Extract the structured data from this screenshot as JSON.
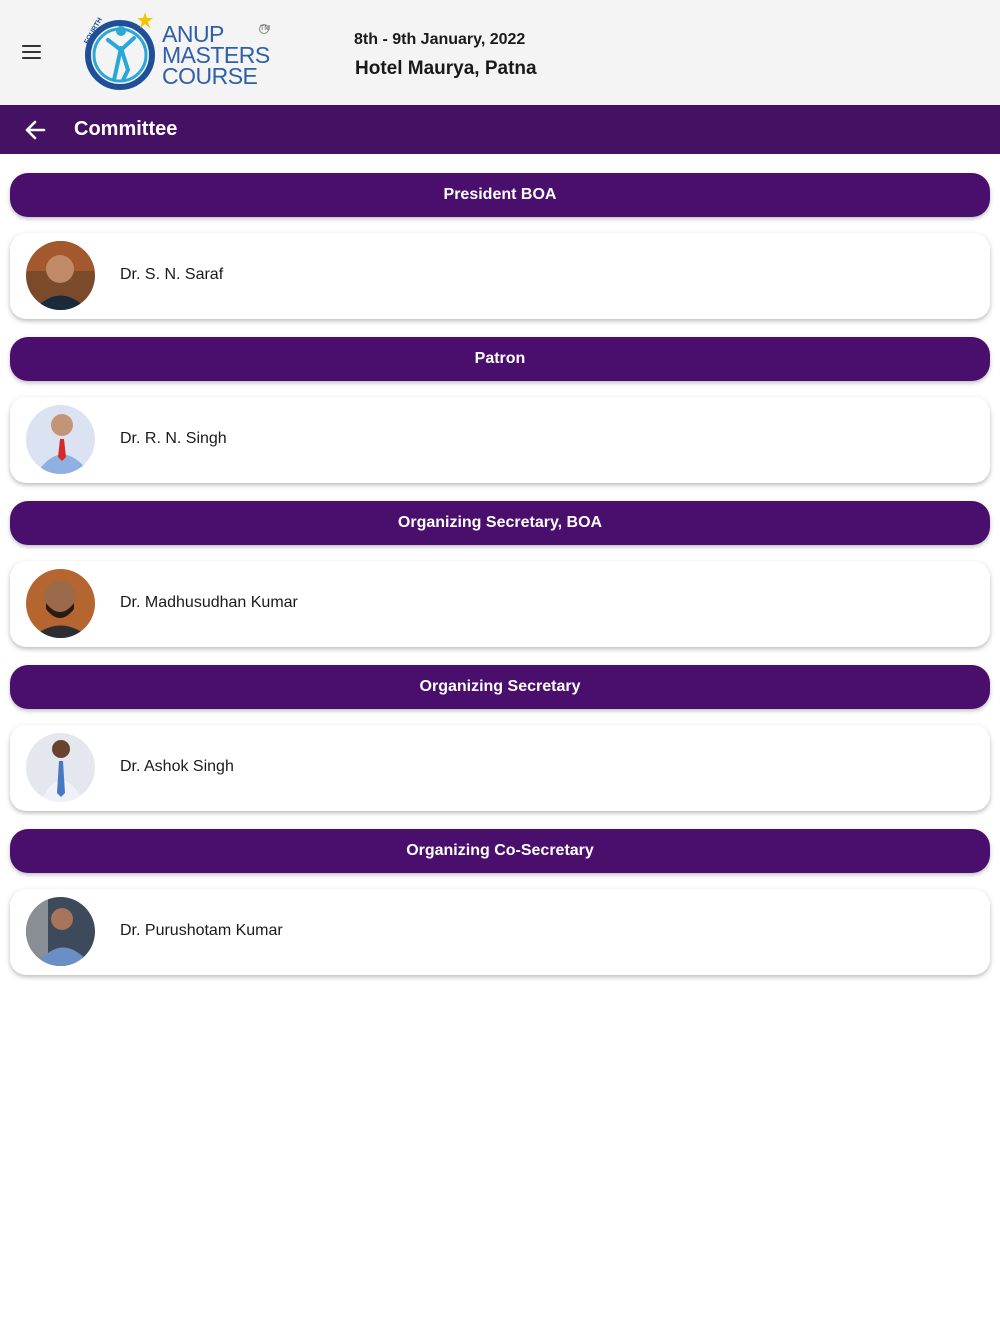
{
  "header": {
    "logo": {
      "badge_text": "FOURTH",
      "line1": "ANUP",
      "line2": "MASTERS",
      "line3": "COURSE",
      "tm": "TM"
    },
    "event_date": "8th - 9th January, 2022",
    "event_venue": "Hotel Maurya, Patna"
  },
  "app_bar": {
    "title": "Committee"
  },
  "sections": [
    {
      "role": "President BOA",
      "member": "Dr. S. N. Saraf"
    },
    {
      "role": "Patron",
      "member": "Dr. R. N. Singh"
    },
    {
      "role": "Organizing Secretary, BOA",
      "member": "Dr. Madhusudhan Kumar"
    },
    {
      "role": "Organizing Secretary",
      "member": "Dr. Ashok Singh"
    },
    {
      "role": "Organizing Co-Secretary",
      "member": "Dr. Purushotam Kumar"
    }
  ],
  "colors": {
    "app_bar": "#451263",
    "role_header": "#4a0f6c",
    "logo_blue": "#2f5fa8"
  }
}
